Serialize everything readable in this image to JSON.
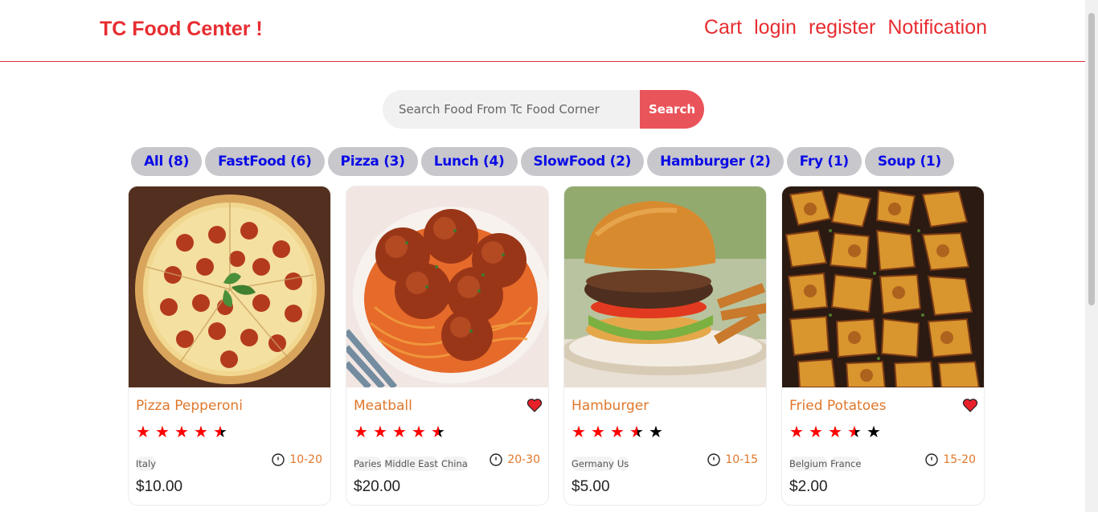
{
  "header": {
    "logo": "TC Food Center !",
    "nav": [
      "Cart",
      "login",
      "register",
      "Notification"
    ]
  },
  "search": {
    "placeholder": "Search Food From Tc Food Corner",
    "button_label": "Search"
  },
  "tags": [
    "All (8)",
    "FastFood (6)",
    "Pizza (3)",
    "Lunch (4)",
    "SlowFood (2)",
    "Hamburger (2)",
    "Fry (1)",
    "Soup (1)"
  ],
  "foods": [
    {
      "name": "Pizza Pepperoni",
      "rating": 4.5,
      "favorite": false,
      "origins": [
        "Italy"
      ],
      "cook_time": "10-20",
      "price": "$10.00",
      "image": "pizza"
    },
    {
      "name": "Meatball",
      "rating": 4.5,
      "favorite": true,
      "origins": [
        "Paries",
        "Middle East",
        "China"
      ],
      "cook_time": "20-30",
      "price": "$20.00",
      "image": "meatball"
    },
    {
      "name": "Hamburger",
      "rating": 3.5,
      "favorite": false,
      "origins": [
        "Germany",
        "Us"
      ],
      "cook_time": "10-15",
      "price": "$5.00",
      "image": "burger"
    },
    {
      "name": "Fried Potatoes",
      "rating": 3.5,
      "favorite": true,
      "origins": [
        "Belgium",
        "France"
      ],
      "cook_time": "15-20",
      "price": "$2.00",
      "image": "potatoes"
    }
  ],
  "colors": {
    "accent": "#e72d31",
    "tag_text": "#0b0be6",
    "food_name": "#e0772b",
    "star": "#ff0000"
  }
}
